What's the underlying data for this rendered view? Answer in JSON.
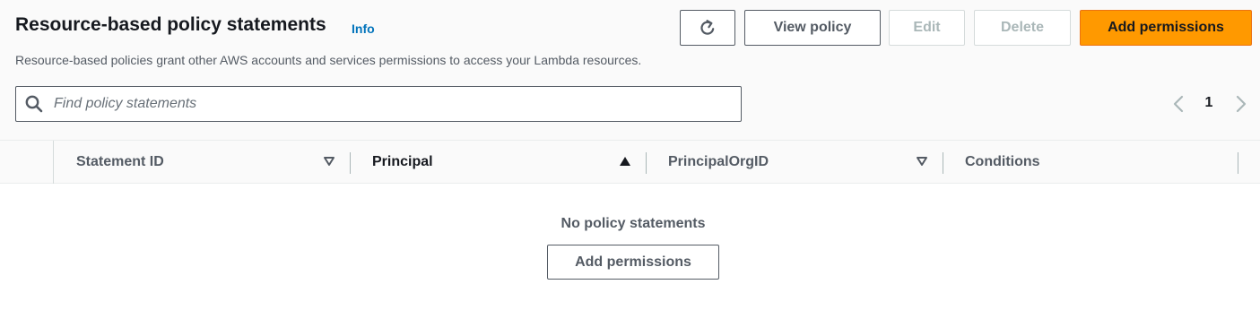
{
  "header": {
    "title": "Resource-based policy statements",
    "info_label": "Info",
    "description": "Resource-based policies grant other AWS accounts and services permissions to access your Lambda resources."
  },
  "actions": {
    "refresh_icon": "refresh-icon",
    "view_policy_label": "View policy",
    "edit_label": "Edit",
    "delete_label": "Delete",
    "add_permissions_label": "Add permissions"
  },
  "search": {
    "placeholder": "Find policy statements",
    "value": "",
    "icon": "search-icon"
  },
  "pagination": {
    "current_page": "1",
    "prev_icon": "chevron-left-icon",
    "next_icon": "chevron-right-icon"
  },
  "table": {
    "columns": [
      {
        "label": "Statement ID",
        "sort": "none"
      },
      {
        "label": "Principal",
        "sort": "ascending"
      },
      {
        "label": "PrincipalOrgID",
        "sort": "none"
      },
      {
        "label": "Conditions",
        "sort": "none"
      }
    ],
    "rows": [],
    "empty_title": "No policy statements",
    "empty_action_label": "Add permissions"
  },
  "colors": {
    "primary_button": "#ff9900",
    "link": "#0073bb",
    "disabled": "#aab7b8"
  }
}
